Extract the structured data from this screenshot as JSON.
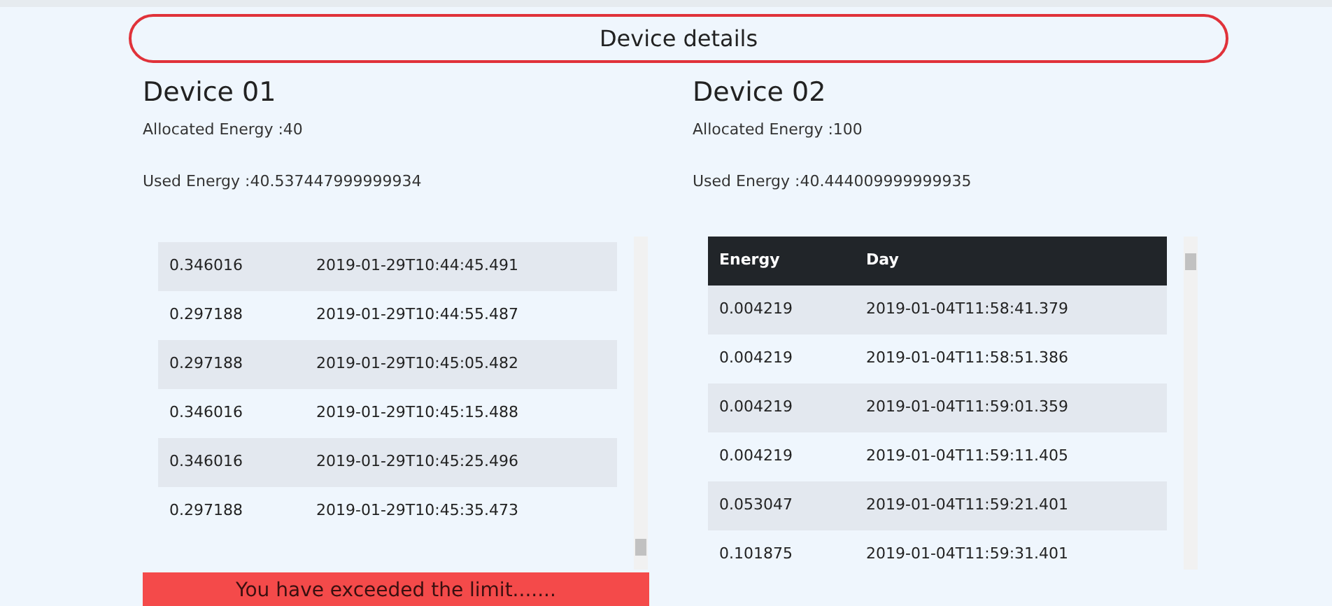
{
  "header": {
    "title": "Device details"
  },
  "devices": [
    {
      "name": "Device 01",
      "allocated": "Allocated Energy :40",
      "used": "Used Energy :40.537447999999934",
      "table": {
        "rows": [
          {
            "energy": "0.346016",
            "day": "2019-01-29T10:44:45.491"
          },
          {
            "energy": "0.297188",
            "day": "2019-01-29T10:44:55.487"
          },
          {
            "energy": "0.297188",
            "day": "2019-01-29T10:45:05.482"
          },
          {
            "energy": "0.346016",
            "day": "2019-01-29T10:45:15.488"
          },
          {
            "energy": "0.346016",
            "day": "2019-01-29T10:45:25.496"
          },
          {
            "energy": "0.297188",
            "day": "2019-01-29T10:45:35.473"
          }
        ]
      },
      "alert": "You have exceeded the limit......."
    },
    {
      "name": "Device 02",
      "allocated": "Allocated Energy :100",
      "used": "Used Energy :40.444009999999935",
      "table": {
        "columns": [
          "Energy",
          "Day"
        ],
        "rows": [
          {
            "energy": "0.004219",
            "day": "2019-01-04T11:58:41.379"
          },
          {
            "energy": "0.004219",
            "day": "2019-01-04T11:58:51.386"
          },
          {
            "energy": "0.004219",
            "day": "2019-01-04T11:59:01.359"
          },
          {
            "energy": "0.004219",
            "day": "2019-01-04T11:59:11.405"
          },
          {
            "energy": "0.053047",
            "day": "2019-01-04T11:59:21.401"
          },
          {
            "energy": "0.101875",
            "day": "2019-01-04T11:59:31.401"
          }
        ]
      }
    }
  ]
}
